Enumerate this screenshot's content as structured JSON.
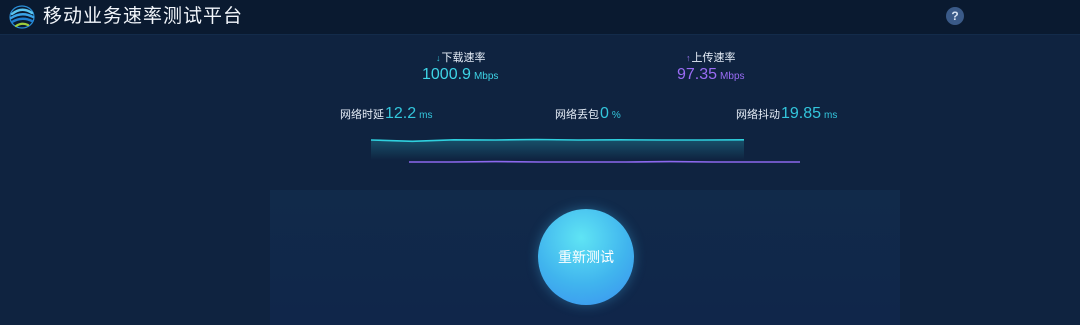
{
  "header": {
    "title": "移动业务速率测试平台",
    "help_icon": "?"
  },
  "download": {
    "label": "下载速率",
    "arrow": "↓",
    "value": "1000.9",
    "unit": "Mbps"
  },
  "upload": {
    "label": "上传速率",
    "arrow": "↑",
    "value": "97.35",
    "unit": "Mbps"
  },
  "latency": {
    "label": "网络时延",
    "value": "12.2",
    "unit": "ms"
  },
  "packet_loss": {
    "label": "网络丢包",
    "value": "0",
    "unit": "%"
  },
  "jitter": {
    "label": "网络抖动",
    "value": "19.85",
    "unit": "ms"
  },
  "colors": {
    "download": "#3ed4e6",
    "upload": "#9a6cf5",
    "background": "#0f2340",
    "button": "#40b4ee"
  },
  "chart_data": {
    "type": "line",
    "series": [
      {
        "values": [
          1000,
          995,
          1001,
          1000,
          1002,
          1000,
          1001,
          1000,
          1000,
          1001
        ]
      },
      {
        "values": [
          97,
          97,
          98,
          97,
          97,
          97,
          98,
          97,
          97,
          97
        ]
      }
    ]
  },
  "retest_button": {
    "label": "重新测试"
  }
}
